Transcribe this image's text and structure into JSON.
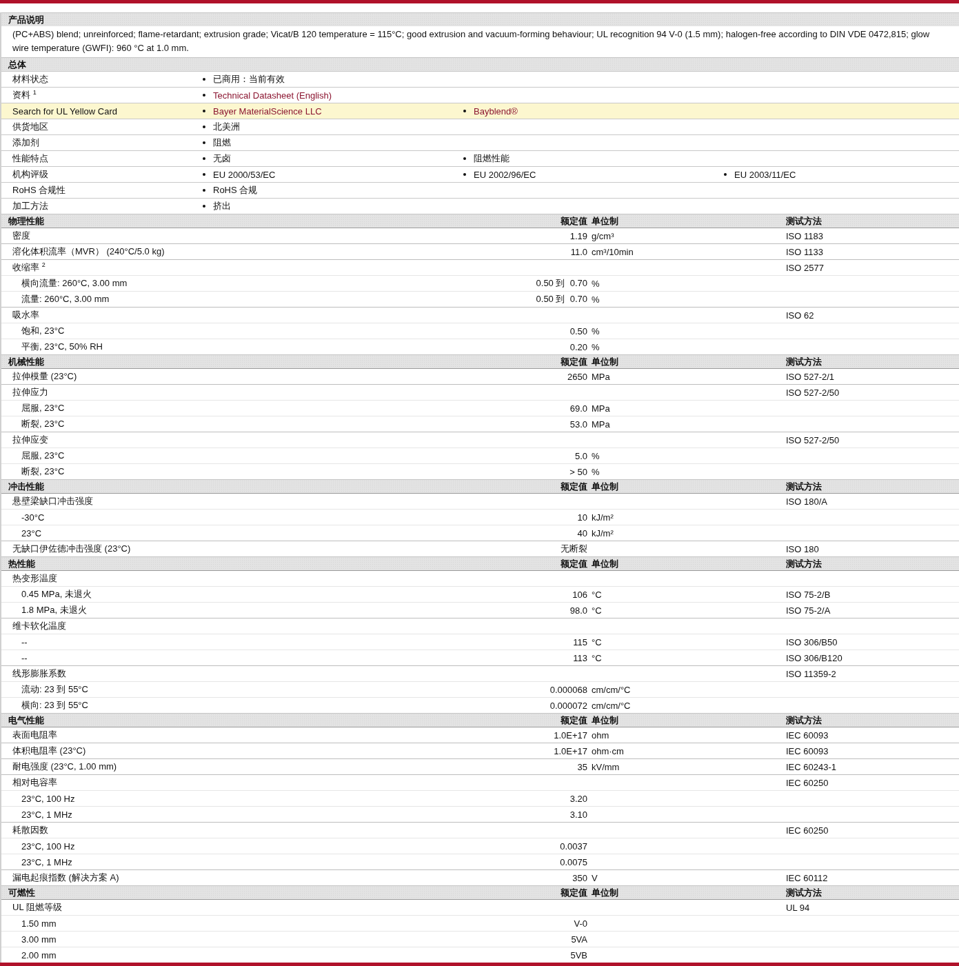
{
  "description": {
    "title": "产品说明",
    "text": "(PC+ABS) blend; unreinforced; flame-retardant; extrusion grade; Vicat/B 120 temperature = 115°C; good extrusion and vacuum-forming behaviour; UL recognition 94 V-0 (1.5 mm); halogen-free according to DIN VDE 0472,815; glow wire temperature (GWFI): 960 °C at 1.0 mm."
  },
  "general": {
    "title": "总体",
    "rows": [
      {
        "label": "材料状态",
        "highlighted": false,
        "values": [
          {
            "text": "已商用：当前有效",
            "link": false
          }
        ]
      },
      {
        "label": "资料 $^{1}$",
        "highlighted": false,
        "values": [
          {
            "text": "Technical Datasheet (English)",
            "link": true
          }
        ]
      },
      {
        "label": "Search for UL Yellow Card",
        "highlighted": true,
        "values": [
          {
            "text": "Bayer MaterialScience LLC",
            "link": true
          },
          {
            "text": "Bayblend®",
            "link": true
          }
        ]
      },
      {
        "label": "供货地区",
        "highlighted": false,
        "values": [
          {
            "text": "北美洲",
            "link": false
          }
        ]
      },
      {
        "label": "添加剂",
        "highlighted": false,
        "values": [
          {
            "text": "阻燃",
            "link": false
          }
        ]
      },
      {
        "label": "性能特点",
        "highlighted": false,
        "values": [
          {
            "text": "无卤",
            "link": false
          },
          {
            "text": "阻燃性能",
            "link": false
          }
        ]
      },
      {
        "label": "机构评级",
        "highlighted": false,
        "values": [
          {
            "text": "EU 2000/53/EC",
            "link": false
          },
          {
            "text": "EU 2002/96/EC",
            "link": false
          },
          {
            "text": "EU 2003/11/EC",
            "link": false
          }
        ]
      },
      {
        "label": "RoHS 合规性",
        "highlighted": false,
        "values": [
          {
            "text": "RoHS 合规",
            "link": false
          }
        ]
      },
      {
        "label": "加工方法",
        "highlighted": false,
        "values": [
          {
            "text": "挤出",
            "link": false
          }
        ]
      }
    ]
  },
  "sections": [
    {
      "title": "物理性能",
      "value_heading": "额定值",
      "unit_heading": "单位制",
      "method_heading": "测试方法",
      "rows": [
        {
          "label": "密度",
          "value": "1.19",
          "unit": "g/cm³",
          "method": "ISO 1183"
        },
        {
          "label": "溶化体积流率（MVR） (240°C/5.0 kg)",
          "value": "11.0",
          "unit": "cm³/10min",
          "method": "ISO 1133"
        },
        {
          "label": "收缩率 $^{2}$",
          "method": "ISO 2577",
          "children": [
            {
              "label": "横向流量: 260°C, 3.00 mm",
              "value": "0.50 到  0.70",
              "unit": "%"
            },
            {
              "label": "流量: 260°C, 3.00 mm",
              "value": "0.50 到  0.70",
              "unit": "%"
            }
          ]
        },
        {
          "label": "吸水率",
          "method": "ISO 62",
          "children": [
            {
              "label": "饱和, 23°C",
              "value": "0.50",
              "unit": "%"
            },
            {
              "label": "平衡, 23°C, 50% RH",
              "value": "0.20",
              "unit": "%"
            }
          ]
        }
      ]
    },
    {
      "title": "机械性能",
      "value_heading": "额定值",
      "unit_heading": "单位制",
      "method_heading": "测试方法",
      "rows": [
        {
          "label": "拉伸模量 (23°C)",
          "value": "2650",
          "unit": "MPa",
          "method": "ISO 527-2/1"
        },
        {
          "label": "拉伸应力",
          "method": "ISO 527-2/50",
          "children": [
            {
              "label": "屈服, 23°C",
              "value": "69.0",
              "unit": "MPa"
            },
            {
              "label": "断裂, 23°C",
              "value": "53.0",
              "unit": "MPa"
            }
          ]
        },
        {
          "label": "拉伸应变",
          "method": "ISO 527-2/50",
          "children": [
            {
              "label": "屈服, 23°C",
              "value": "5.0",
              "unit": "%"
            },
            {
              "label": "断裂, 23°C",
              "value": "> 50",
              "unit": "%"
            }
          ]
        }
      ]
    },
    {
      "title": "冲击性能",
      "value_heading": "额定值",
      "unit_heading": "单位制",
      "method_heading": "测试方法",
      "rows": [
        {
          "label": "悬壁梁缺口冲击强度",
          "method": "ISO 180/A",
          "children": [
            {
              "label": "-30°C",
              "value": "10",
              "unit": "kJ/m²"
            },
            {
              "label": "23°C",
              "value": "40",
              "unit": "kJ/m²"
            }
          ]
        },
        {
          "label": "无缺口伊佐德冲击强度 (23°C)",
          "value": "无断裂",
          "method": "ISO 180"
        }
      ]
    },
    {
      "title": "热性能",
      "value_heading": "额定值",
      "unit_heading": "单位制",
      "method_heading": "测试方法",
      "rows": [
        {
          "label": "热变形温度",
          "children": [
            {
              "label": "0.45 MPa, 未退火",
              "value": "106",
              "unit": "°C",
              "method": "ISO 75-2/B"
            },
            {
              "label": "1.8 MPa, 未退火",
              "value": "98.0",
              "unit": "°C",
              "method": "ISO 75-2/A"
            }
          ]
        },
        {
          "label": "维卡软化温度",
          "children": [
            {
              "label": "--",
              "value": "115",
              "unit": "°C",
              "method": "ISO 306/B50"
            },
            {
              "label": "--",
              "value": "113",
              "unit": "°C",
              "method": "ISO 306/B120"
            }
          ]
        },
        {
          "label": "线形膨胀系数",
          "method": "ISO 11359-2",
          "children": [
            {
              "label": "流动: 23 到  55°C",
              "value": "0.000068",
              "unit": "cm/cm/°C"
            },
            {
              "label": "横向: 23 到  55°C",
              "value": "0.000072",
              "unit": "cm/cm/°C"
            }
          ]
        }
      ]
    },
    {
      "title": "电气性能",
      "value_heading": "额定值",
      "unit_heading": "单位制",
      "method_heading": "测试方法",
      "rows": [
        {
          "label": "表面电阻率",
          "value": "1.0E+17",
          "unit": "ohm",
          "method": "IEC 60093"
        },
        {
          "label": "体积电阻率 (23°C)",
          "value": "1.0E+17",
          "unit": "ohm·cm",
          "method": "IEC 60093"
        },
        {
          "label": "耐电强度 (23°C, 1.00 mm)",
          "value": "35",
          "unit": "kV/mm",
          "method": "IEC 60243-1"
        },
        {
          "label": "相对电容率",
          "method": "IEC 60250",
          "children": [
            {
              "label": "23°C, 100 Hz",
              "value": "3.20"
            },
            {
              "label": "23°C, 1 MHz",
              "value": "3.10"
            }
          ]
        },
        {
          "label": "耗散因数",
          "method": "IEC 60250",
          "children": [
            {
              "label": "23°C, 100 Hz",
              "value": "0.0037"
            },
            {
              "label": "23°C, 1 MHz",
              "value": "0.0075"
            }
          ]
        },
        {
          "label": "漏电起痕指数 (解决方案 A)",
          "value": "350",
          "unit": "V",
          "method": "IEC 60112"
        }
      ]
    },
    {
      "title": "可燃性",
      "value_heading": "额定值",
      "unit_heading": "单位制",
      "method_heading": "测试方法",
      "rows": [
        {
          "label": "UL 阻燃等级",
          "method": "UL 94",
          "children": [
            {
              "label": "1.50 mm",
              "value": "V-0"
            },
            {
              "label": "3.00 mm",
              "value": "5VA"
            },
            {
              "label": "2.00 mm",
              "value": "5VB"
            }
          ]
        }
      ]
    }
  ]
}
